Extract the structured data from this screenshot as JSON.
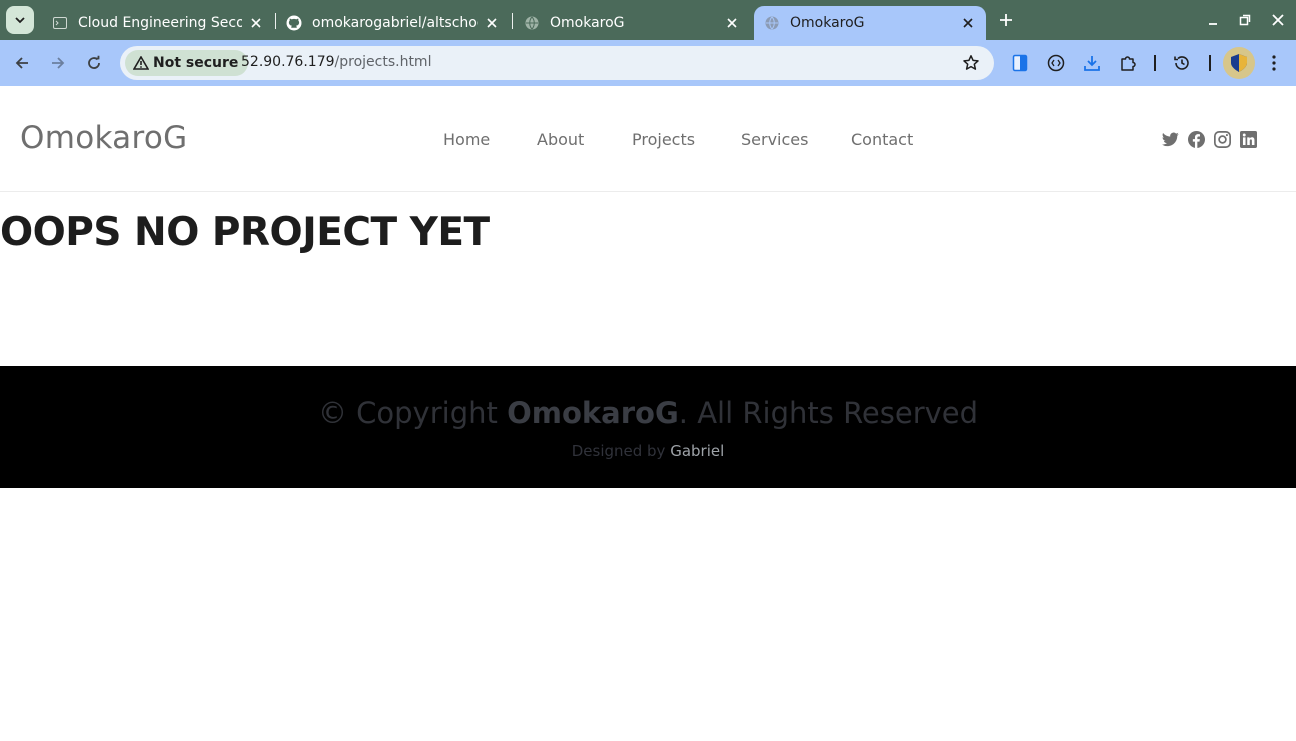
{
  "browser": {
    "tabs": [
      {
        "title": "Cloud Engineering Secon",
        "favicon": "terminal-icon",
        "active": false
      },
      {
        "title": "omokarogabriel/altschoo",
        "favicon": "github-icon",
        "active": false
      },
      {
        "title": "OmokaroG",
        "favicon": "globe-icon",
        "active": false
      },
      {
        "title": "OmokaroG",
        "favicon": "globe-icon",
        "active": true
      }
    ],
    "security_label": "Not secure",
    "url_host": "52.90.76.179",
    "url_path": "/projects.html",
    "colors": {
      "frame": "#4b6a5a",
      "toolbar": "#a8c7fa",
      "omnibox": "#eaf1f8"
    }
  },
  "site": {
    "logo": "OmokaroG",
    "nav": [
      "Home",
      "About",
      "Projects",
      "Services",
      "Contact"
    ],
    "social_icons": [
      "twitter-icon",
      "facebook-icon",
      "instagram-icon",
      "linkedin-icon"
    ],
    "headline": "OOPS NO PROJECT YET",
    "footer": {
      "copyright_prefix": "© Copyright ",
      "copyright_brand": "OmokaroG",
      "copyright_suffix": ". All Rights Reserved",
      "designed_by": "Designed by ",
      "designer": "Gabriel"
    }
  }
}
